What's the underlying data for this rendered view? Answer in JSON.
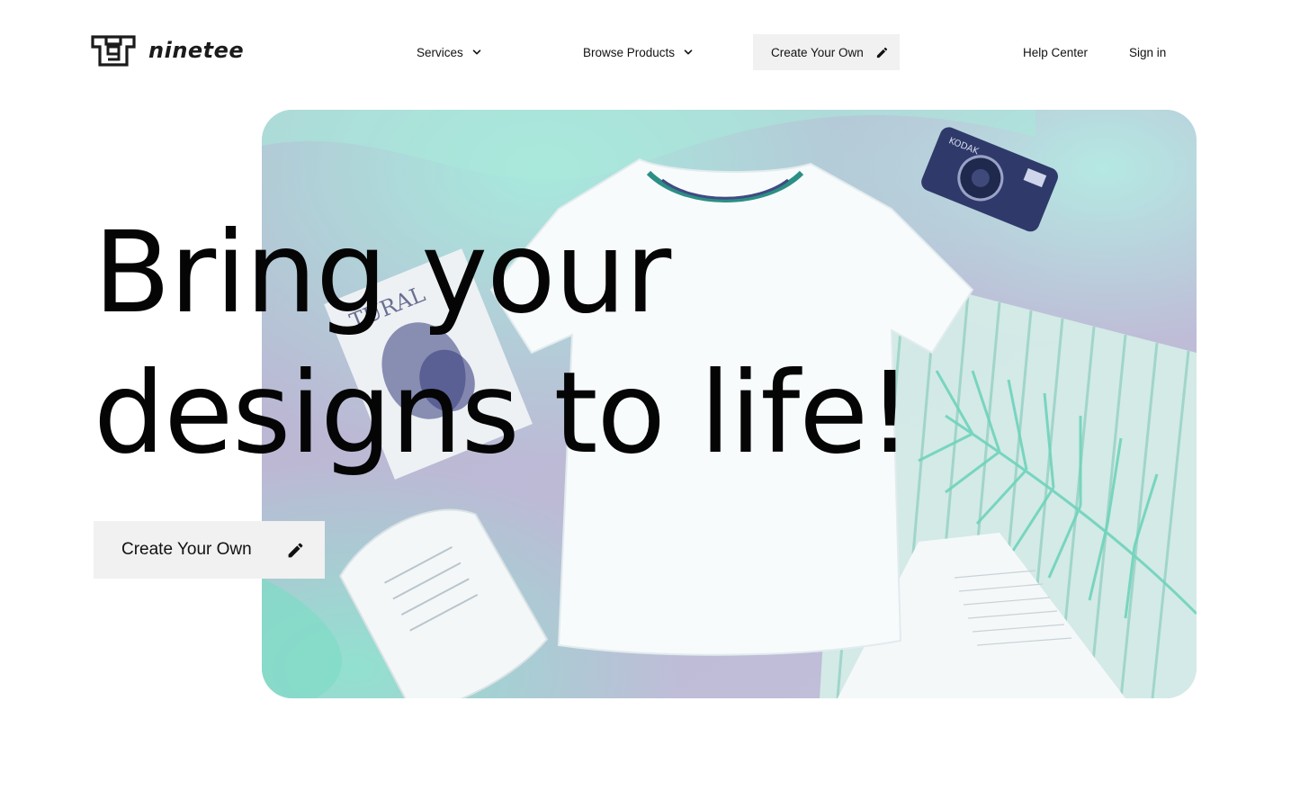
{
  "brand": {
    "name": "ninetee",
    "logo_icon": "tshirt-logo-icon"
  },
  "nav": {
    "services_label": "Services",
    "browse_label": "Browse Products",
    "create_label": "Create Your Own",
    "help_label": "Help Center",
    "signin_label": "Sign in",
    "dropdown_icon": "chevron-down-icon",
    "create_icon": "pencil-icon"
  },
  "hero": {
    "title_line1": "Bring your",
    "title_line2": "designs to life!",
    "cta_label": "Create Your Own",
    "cta_icon": "pencil-icon",
    "image_description_icon": "hero-photo"
  },
  "colors": {
    "accent_mint": "#a8e8dc",
    "accent_lavender": "#b9b7d3",
    "button_bg": "#f1f1f1",
    "text": "#111111"
  }
}
